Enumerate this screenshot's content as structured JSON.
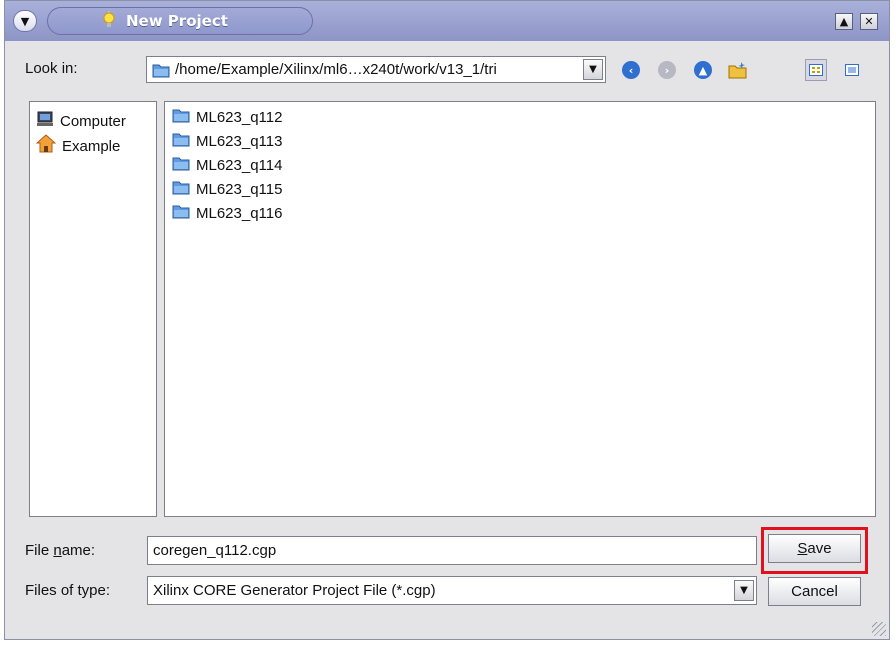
{
  "window": {
    "title": "New Project"
  },
  "look_in": {
    "label": "Look in:",
    "path": "/home/Example/Xilinx/ml6…x240t/work/v13_1/tri"
  },
  "toolbar": {
    "icons": [
      "back-icon",
      "forward-icon",
      "up-folder-icon",
      "new-folder-icon",
      "list-view-icon",
      "details-view-icon"
    ]
  },
  "places": {
    "items": [
      {
        "label": "Computer",
        "icon": "computer-icon"
      },
      {
        "label": "Example",
        "icon": "home-icon"
      }
    ]
  },
  "files": {
    "items": [
      {
        "label": "ML623_q112"
      },
      {
        "label": "ML623_q113"
      },
      {
        "label": "ML623_q114"
      },
      {
        "label": "ML623_q115"
      },
      {
        "label": "ML623_q116"
      }
    ]
  },
  "file_name": {
    "label_pre": "File ",
    "label_mnemonic": "n",
    "label_post": "ame:",
    "value": "coregen_q112.cgp"
  },
  "file_type": {
    "label": "Files of type:",
    "value": "Xilinx CORE Generator Project File (*.cgp)"
  },
  "buttons": {
    "save_mnemonic": "S",
    "save_rest": "ave",
    "cancel": "Cancel"
  },
  "colors": {
    "titlebar": "#8d95c6",
    "highlight": "#e0101e",
    "folder": "#3a78c9"
  }
}
